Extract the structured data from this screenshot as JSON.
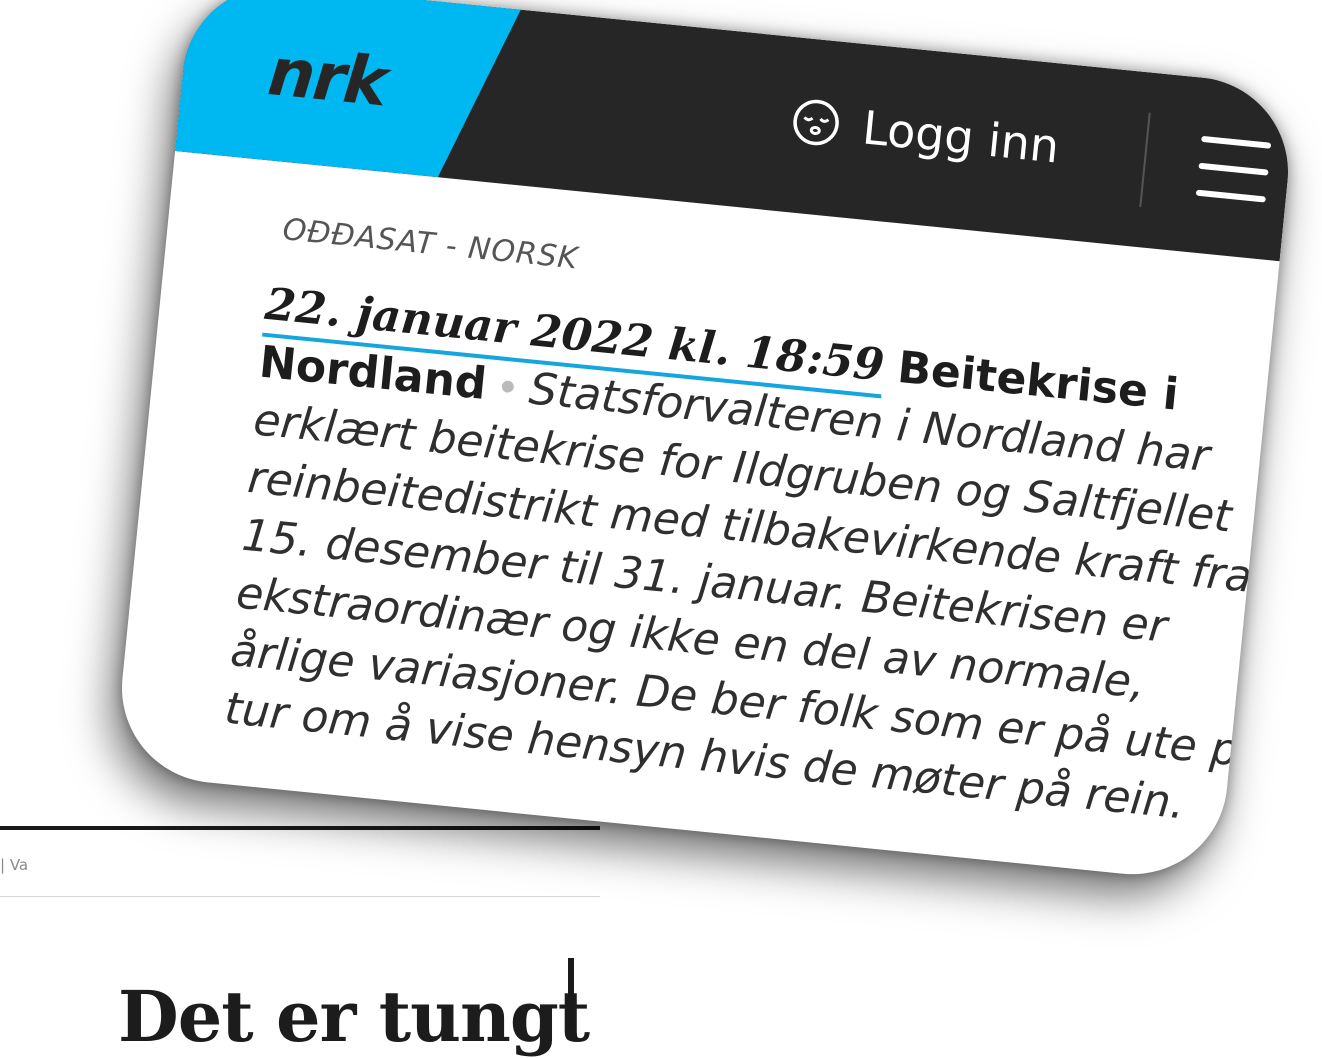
{
  "background": {
    "breadcrumb": "| Va",
    "headline": "Det er tungt"
  },
  "header": {
    "logo": "nrk",
    "login_label": "Logg inn",
    "login_icon": "sleepy-face-icon",
    "menu_icon": "hamburger-menu-icon"
  },
  "article": {
    "kicker": "OĐĐASAT - NORSK",
    "date": "22. januar 2022 kl. 18:59",
    "title": "Beitekrise i Nordland",
    "separator": "•",
    "body": "Statsforvalteren i Nordland har erklært beitekrise for Ildgruben og Saltfjellet reinbeitedistrikt med tilbakevirkende kraft fra 15. desember til 31. januar. Beitekrisen er ekstraordinær og ikke en del av normale, årlige variasjoner. De ber folk som er på ute på tur om å vise hensyn hvis de møter på rein."
  },
  "colors": {
    "nrk_blue": "#00b8f1",
    "header_dark": "#262626",
    "underline": "#15a6e0"
  }
}
